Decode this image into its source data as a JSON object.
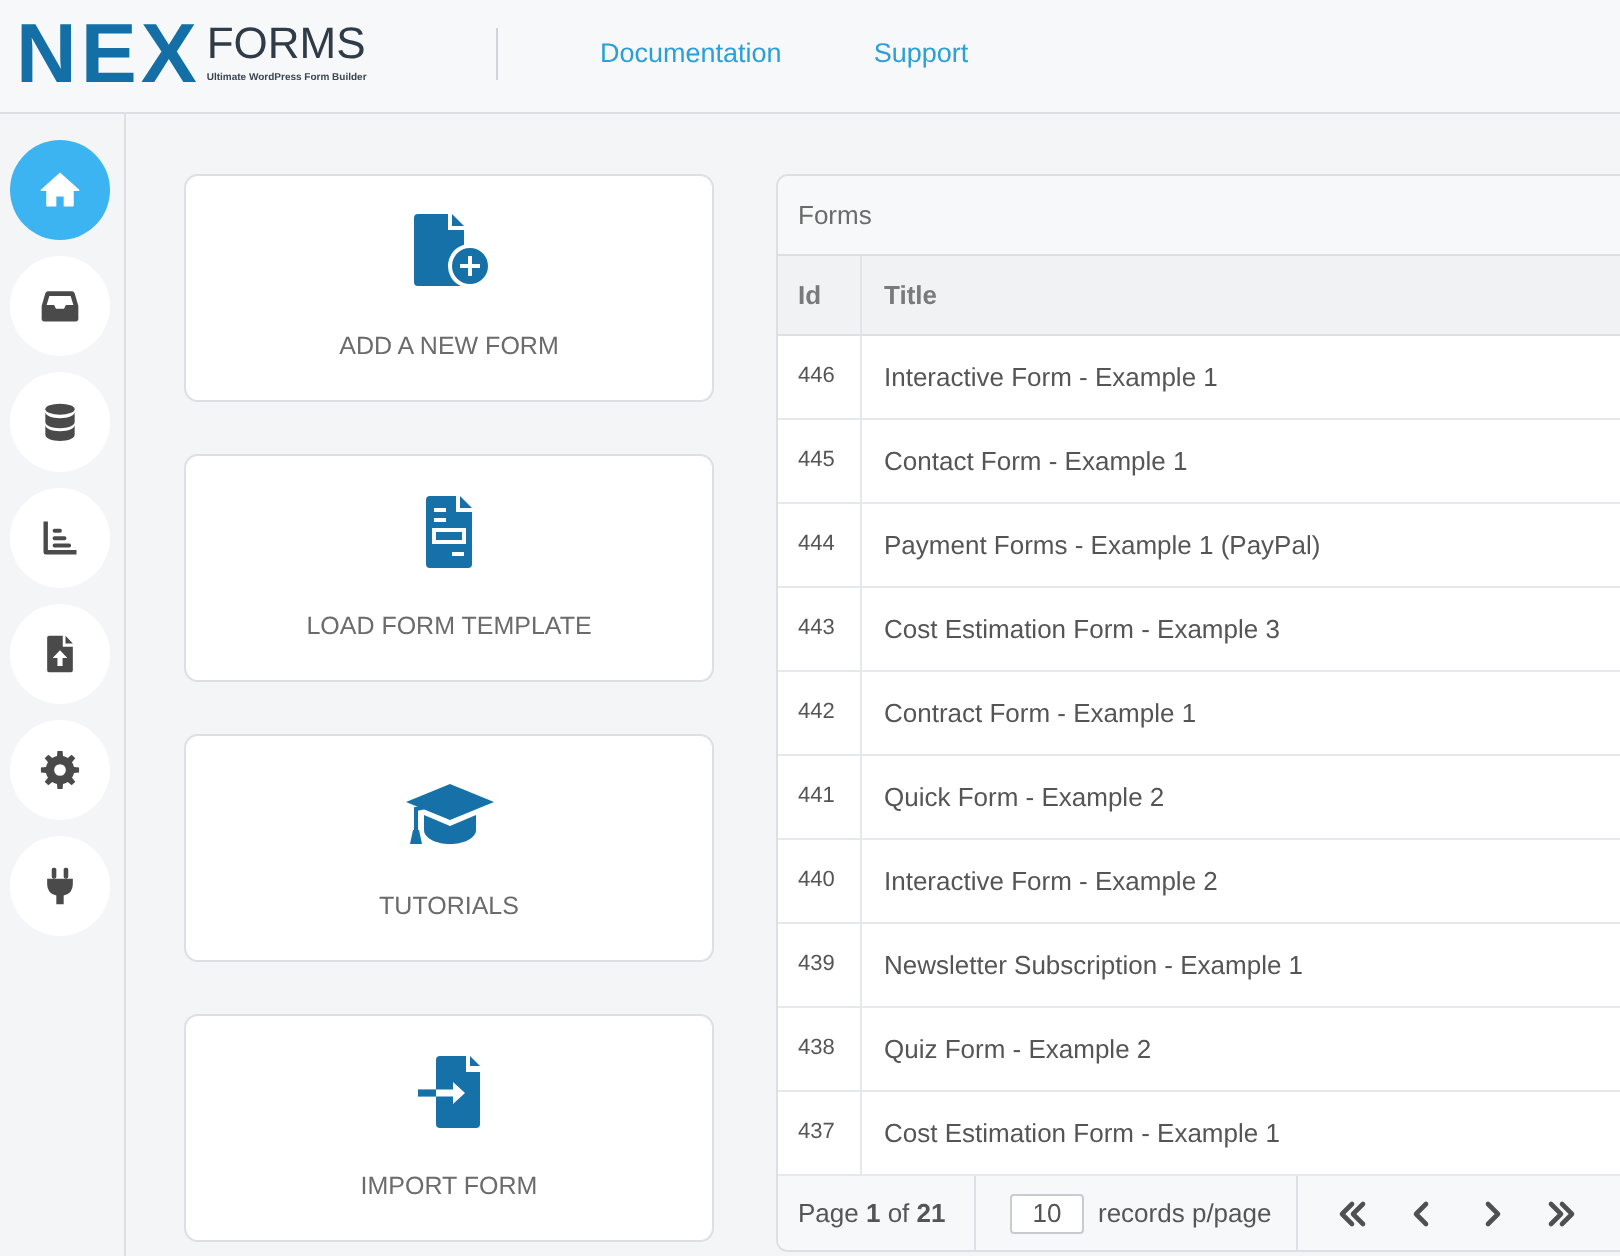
{
  "header": {
    "logo": {
      "mark": "NEX",
      "name": "FORMS",
      "tagline": "Ultimate WordPress Form Builder"
    },
    "links": [
      "Documentation",
      "Support"
    ]
  },
  "sidebar": {
    "items": [
      {
        "selected": true
      },
      {
        "selected": false
      },
      {
        "selected": false
      },
      {
        "selected": false
      },
      {
        "selected": false
      },
      {
        "selected": false
      },
      {
        "selected": false
      }
    ]
  },
  "actions": [
    "ADD A NEW FORM",
    "LOAD FORM TEMPLATE",
    "TUTORIALS",
    "IMPORT FORM"
  ],
  "forms_table": {
    "title": "Forms",
    "columns": [
      "Id",
      "Title"
    ],
    "rows": [
      {
        "id": "446",
        "title": "Interactive Form - Example 1"
      },
      {
        "id": "445",
        "title": "Contact Form - Example 1"
      },
      {
        "id": "444",
        "title": "Payment Forms - Example 1 (PayPal)"
      },
      {
        "id": "443",
        "title": "Cost Estimation Form - Example 3"
      },
      {
        "id": "442",
        "title": "Contract Form - Example 1"
      },
      {
        "id": "441",
        "title": "Quick Form - Example 2"
      },
      {
        "id": "440",
        "title": "Interactive Form - Example 2"
      },
      {
        "id": "439",
        "title": "Newsletter Subscription - Example 1"
      },
      {
        "id": "438",
        "title": "Quiz Form - Example 2"
      },
      {
        "id": "437",
        "title": "Cost Estimation Form - Example 1"
      }
    ],
    "pagination": {
      "page_text": "Page **1** of **21**",
      "per_page": "10",
      "per_page_label": "records p/page"
    }
  }
}
